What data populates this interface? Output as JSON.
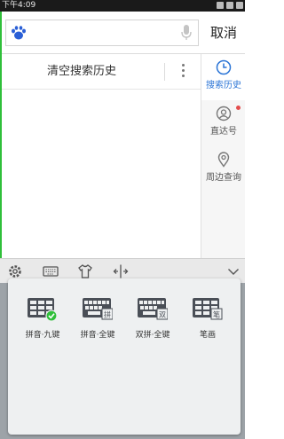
{
  "status_bar": {
    "time": "下午4:09"
  },
  "search": {
    "placeholder": "",
    "cancel_label": "取消"
  },
  "history": {
    "clear_label": "清空搜索历史"
  },
  "side_panel": {
    "items": [
      {
        "label": "搜索历史",
        "icon": "clock-icon",
        "active": true
      },
      {
        "label": "直达号",
        "icon": "user-icon",
        "badge": true
      },
      {
        "label": "周边查询",
        "icon": "location-pin-icon"
      }
    ]
  },
  "keyboard_toolbar": {
    "icons": [
      "gear-icon",
      "keyboard-icon",
      "tshirt-icon",
      "cursor-move-icon",
      "chevron-down-icon"
    ]
  },
  "keyboard_layouts": [
    {
      "label": "拼音·九键",
      "selected": true
    },
    {
      "label": "拼音·全键",
      "tag": "拼",
      "selected": false
    },
    {
      "label": "双拼·全键",
      "tag": "双",
      "selected": false
    },
    {
      "label": "笔画",
      "tag": "笔",
      "selected": false
    }
  ],
  "colors": {
    "accent": "#2a74d6",
    "badge": "#e34c4c",
    "check": "#2fbf3a"
  }
}
